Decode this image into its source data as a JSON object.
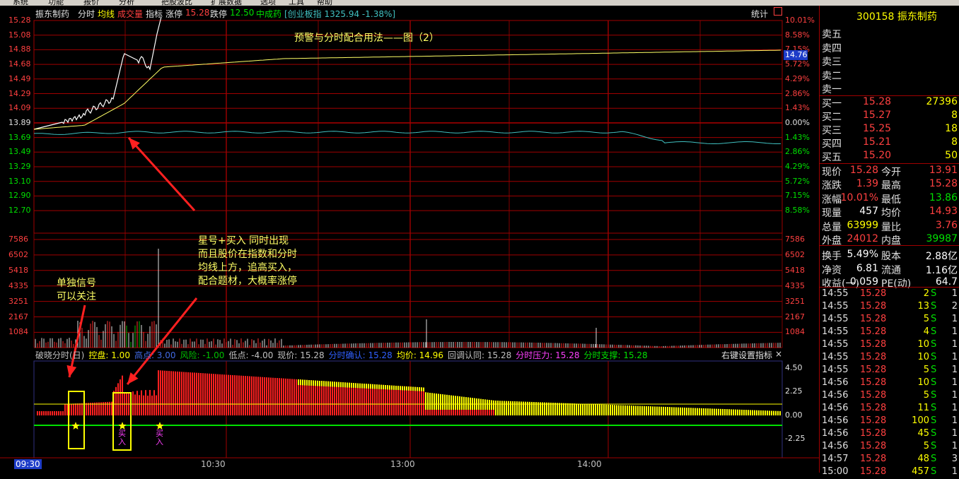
{
  "menubar": {
    "items": [
      "系统",
      "功能",
      "报价",
      "分析",
      "把股波比",
      "扩展数据",
      "选项",
      "工具",
      "帮助"
    ]
  },
  "header": {
    "stock_name": "振东制药",
    "tabs": [
      "分时",
      "均线",
      "成交量",
      "指标"
    ],
    "limit_up_label": "涨停",
    "limit_up_value": "15.28",
    "limit_down_label": "跌停",
    "limit_down_value": "12.50",
    "index_label": "中成药",
    "board_label": "[创业板指 1325.94 -1.38%]",
    "stats_label": "统计"
  },
  "chart_title": "预警与分时配合用法——图（2）",
  "price_axis": {
    "left": [
      "15.28",
      "15.08",
      "14.88",
      "14.68",
      "14.49",
      "14.29",
      "14.09",
      "13.89",
      "13.69",
      "13.49",
      "13.29",
      "13.10",
      "12.90",
      "12.70"
    ],
    "right": [
      "10.01%",
      "8.58%",
      "7.15%",
      "5.72%",
      "4.29%",
      "2.86%",
      "1.43%",
      "0.00%",
      "1.43%",
      "2.86%",
      "4.29%",
      "5.72%",
      "7.15%",
      "8.58%"
    ],
    "current_price_tag": "14.76"
  },
  "volume_axis": {
    "labels": [
      "7586",
      "6502",
      "5418",
      "4335",
      "3251",
      "2167",
      "1084"
    ]
  },
  "indicator": {
    "header": [
      {
        "text": "破晓分时(日)",
        "color": "#c0c0c0"
      },
      {
        "text": "控盘: 1.00",
        "color": "#ffff00"
      },
      {
        "text": "高点: 3.00",
        "color": "#4169e1"
      },
      {
        "text": "风险: -1.00",
        "color": "#00c000"
      },
      {
        "text": "低点: -4.00",
        "color": "#c0c0c0"
      },
      {
        "text": "现价: 15.28",
        "color": "#c0c0c0"
      },
      {
        "text": "分时确认: 15.28",
        "color": "#3060ff"
      },
      {
        "text": "均价: 14.96",
        "color": "#ffff00"
      },
      {
        "text": "回调认同: 15.28",
        "color": "#c0c0c0"
      },
      {
        "text": "分时压力: 15.28",
        "color": "#ff40ff"
      },
      {
        "text": "分时支撑: 15.28",
        "color": "#00e000"
      }
    ],
    "right_link": "右键设置指标",
    "axis": [
      "4.50",
      "2.25",
      "0.00",
      "-2.25"
    ],
    "buy_label": "买入"
  },
  "time_axis": [
    "09:30",
    "10:30",
    "13:00",
    "14:00"
  ],
  "annotations": {
    "single_signal": [
      "单独信号",
      "可以关注"
    ],
    "combo": [
      "星号+买入   同时出现",
      "而且股价在指数和分时",
      "均线上方，追高买入，",
      "配合题材，大概率涨停"
    ]
  },
  "sidebar": {
    "code": "300158",
    "name": "振东制药",
    "sell_levels": [
      "卖五",
      "卖四",
      "卖三",
      "卖二",
      "卖一"
    ],
    "buy_levels": [
      {
        "label": "买一",
        "price": "15.28",
        "vol": "27396"
      },
      {
        "label": "买二",
        "price": "15.27",
        "vol": "8"
      },
      {
        "label": "买三",
        "price": "15.25",
        "vol": "18"
      },
      {
        "label": "买四",
        "price": "15.21",
        "vol": "8"
      },
      {
        "label": "买五",
        "price": "15.20",
        "vol": "50"
      }
    ],
    "stats": [
      {
        "l1": "现价",
        "v1": "15.28",
        "c1": "#ff4040",
        "l2": "今开",
        "v2": "13.91",
        "c2": "#ff4040"
      },
      {
        "l1": "涨跌",
        "v1": "1.39",
        "c1": "#ff4040",
        "l2": "最高",
        "v2": "15.28",
        "c2": "#ff4040"
      },
      {
        "l1": "涨幅",
        "v1": "10.01%",
        "c1": "#ff4040",
        "l2": "最低",
        "v2": "13.86",
        "c2": "#00e000"
      },
      {
        "l1": "现量",
        "v1": "457",
        "c1": "#ffffff",
        "l2": "均价",
        "v2": "14.93",
        "c2": "#ff4040"
      },
      {
        "l1": "总量",
        "v1": "63999",
        "c1": "#ffff00",
        "l2": "量比",
        "v2": "3.76",
        "c2": "#ff4040"
      },
      {
        "l1": "外盘",
        "v1": "24012",
        "c1": "#ff4040",
        "l2": "内盘",
        "v2": "39987",
        "c2": "#00e000"
      },
      {
        "l1": "换手",
        "v1": "5.49%",
        "c1": "#ffffff",
        "l2": "股本",
        "v2": "2.88亿",
        "c2": "#ffffff"
      },
      {
        "l1": "净资",
        "v1": "6.81",
        "c1": "#ffffff",
        "l2": "流通",
        "v2": "1.16亿",
        "c2": "#ffffff"
      },
      {
        "l1": "收益(一)",
        "v1": "0.059",
        "c1": "#ffffff",
        "l2": "PE(动)",
        "v2": "64.7",
        "c2": "#ffffff"
      }
    ],
    "trades": [
      {
        "time": "14:55",
        "price": "15.28",
        "vol": "2",
        "side": "S",
        "n": "1"
      },
      {
        "time": "14:55",
        "price": "15.28",
        "vol": "13",
        "side": "S",
        "n": "2"
      },
      {
        "time": "14:55",
        "price": "15.28",
        "vol": "5",
        "side": "S",
        "n": "1"
      },
      {
        "time": "14:55",
        "price": "15.28",
        "vol": "4",
        "side": "S",
        "n": "1"
      },
      {
        "time": "14:55",
        "price": "15.28",
        "vol": "10",
        "side": "S",
        "n": "1"
      },
      {
        "time": "14:55",
        "price": "15.28",
        "vol": "10",
        "side": "S",
        "n": "1"
      },
      {
        "time": "14:55",
        "price": "15.28",
        "vol": "5",
        "side": "S",
        "n": "1"
      },
      {
        "time": "14:56",
        "price": "15.28",
        "vol": "10",
        "side": "S",
        "n": "1"
      },
      {
        "time": "14:56",
        "price": "15.28",
        "vol": "5",
        "side": "S",
        "n": "1"
      },
      {
        "time": "14:56",
        "price": "15.28",
        "vol": "11",
        "side": "S",
        "n": "1"
      },
      {
        "time": "14:56",
        "price": "15.28",
        "vol": "100",
        "side": "S",
        "n": "1"
      },
      {
        "time": "14:56",
        "price": "15.28",
        "vol": "45",
        "side": "S",
        "n": "1"
      },
      {
        "time": "14:56",
        "price": "15.28",
        "vol": "5",
        "side": "S",
        "n": "1"
      },
      {
        "time": "14:57",
        "price": "15.28",
        "vol": "48",
        "side": "S",
        "n": "3"
      },
      {
        "time": "15:00",
        "price": "15.28",
        "vol": "457",
        "side": "S",
        "n": "1"
      }
    ]
  },
  "colors": {
    "grid": "#a00000",
    "up": "#ff3030",
    "down": "#00e000",
    "avg": "#ffff00",
    "price": "#ffffff",
    "index": "#40c0c0"
  }
}
